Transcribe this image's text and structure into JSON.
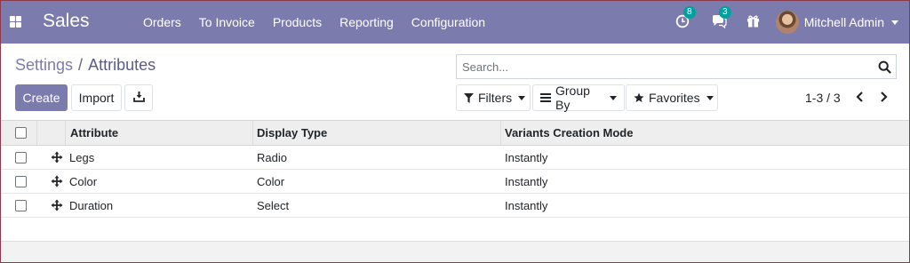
{
  "navbar": {
    "app_name": "Sales",
    "menu": [
      {
        "label": "Orders"
      },
      {
        "label": "To Invoice"
      },
      {
        "label": "Products"
      },
      {
        "label": "Reporting"
      },
      {
        "label": "Configuration"
      }
    ],
    "activity_count": "8",
    "messages_count": "3",
    "user_name": "Mitchell Admin",
    "accent_color": "#7c7bad",
    "badge_color": "#00a09d"
  },
  "breadcrumb": {
    "root": "Settings",
    "separator": "/",
    "current": "Attributes"
  },
  "search": {
    "placeholder": "Search..."
  },
  "buttons": {
    "create": "Create",
    "import": "Import"
  },
  "filters": {
    "filters_label": "Filters",
    "groupby_label": "Group By",
    "favorites_label": "Favorites"
  },
  "pager": {
    "range": "1-3 / 3"
  },
  "table": {
    "columns": [
      "Attribute",
      "Display Type",
      "Variants Creation Mode"
    ],
    "rows": [
      [
        "Legs",
        "Radio",
        "Instantly"
      ],
      [
        "Color",
        "Color",
        "Instantly"
      ],
      [
        "Duration",
        "Select",
        "Instantly"
      ]
    ]
  },
  "icons": {
    "apps": "grid-icon",
    "activity": "clock-icon",
    "messages": "chat-icon",
    "gift": "gift-icon",
    "download": "download-icon",
    "search": "search-icon",
    "filter": "funnel-icon",
    "groupby": "list-icon",
    "favorites": "star-icon",
    "drag": "move-handle-icon"
  }
}
